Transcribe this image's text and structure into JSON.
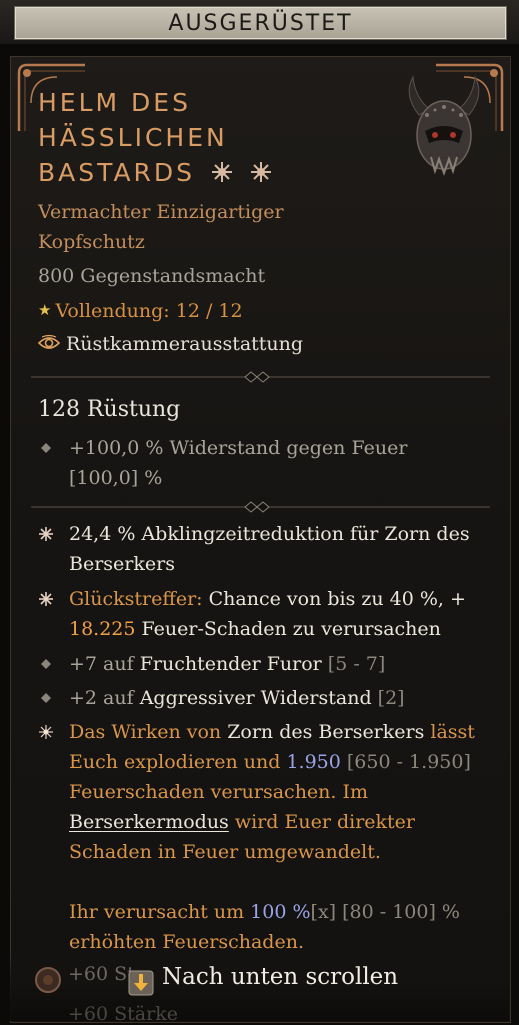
{
  "header": {
    "title": "AUSGERÜSTET"
  },
  "item": {
    "name_lines": [
      "HELM DES",
      "HÄSSLICHEN",
      "BASTARDS"
    ],
    "rarity_lines": [
      "Vermachter Einzigartiger",
      "Kopfschutz"
    ],
    "item_power": "800 Gegenstandsmacht",
    "mastery": "Vollendung: 12 / 12",
    "armory": "Rüstkammerausstattung",
    "armor": "128 Rüstung",
    "implicit": {
      "text": "+100,0 % Widerstand gegen Feuer",
      "range": "[100,0] %"
    },
    "affixes": {
      "a1": {
        "l1": "24,4 % Abklingzeitreduktion für Zorn des",
        "l2": "Berserkers"
      },
      "a2": {
        "lucky": "Glückstreffer:",
        "p1": " Chance von bis zu 40 %, +",
        "num": "18.225",
        "p2": " Feuer-Schaden zu verursachen"
      },
      "a3": {
        "pre": "+7 auf ",
        "skill": "Fruchtender Furor",
        "range": " [5 - 7]"
      },
      "a4": {
        "pre": "+2 auf ",
        "skill": "Aggressiver Widerstand",
        "range": " [2]"
      }
    },
    "unique_power": {
      "l1a": "Das Wirken von ",
      "l1b": "Zorn des Berserkers",
      "l1c": " lässt",
      "l2a": "Euch explodieren und ",
      "l2b": "1.950",
      "l2c": " [650 - 1.950]",
      "l3": "Feuerschaden verursachen. Im",
      "l4a": "Berserkermodus",
      "l4b": " wird Euer direkter",
      "l5": "Schaden in Feuer umgewandelt.",
      "l6a": "Ihr verursacht um ",
      "l6b": "100 %",
      "l6c": "[x]",
      "l6d": " [80 - 100] %",
      "l7": "erhöhten Feuerschaden."
    },
    "ghost_text_1": "+60 St",
    "ghost_text_2": "+60 Stärke"
  },
  "scroll": {
    "label": "Nach unten scrollen"
  },
  "colors": {
    "title": "#d89c64",
    "legendary_orange": "#d99648",
    "value_blue": "#9aa4e8"
  },
  "icons": {
    "unique": "unique-star-icon",
    "mastery": "mastery-star-icon",
    "armory": "armory-eye-icon",
    "helm": "demon-helm-icon",
    "scroll": "scroll-down-icon"
  }
}
